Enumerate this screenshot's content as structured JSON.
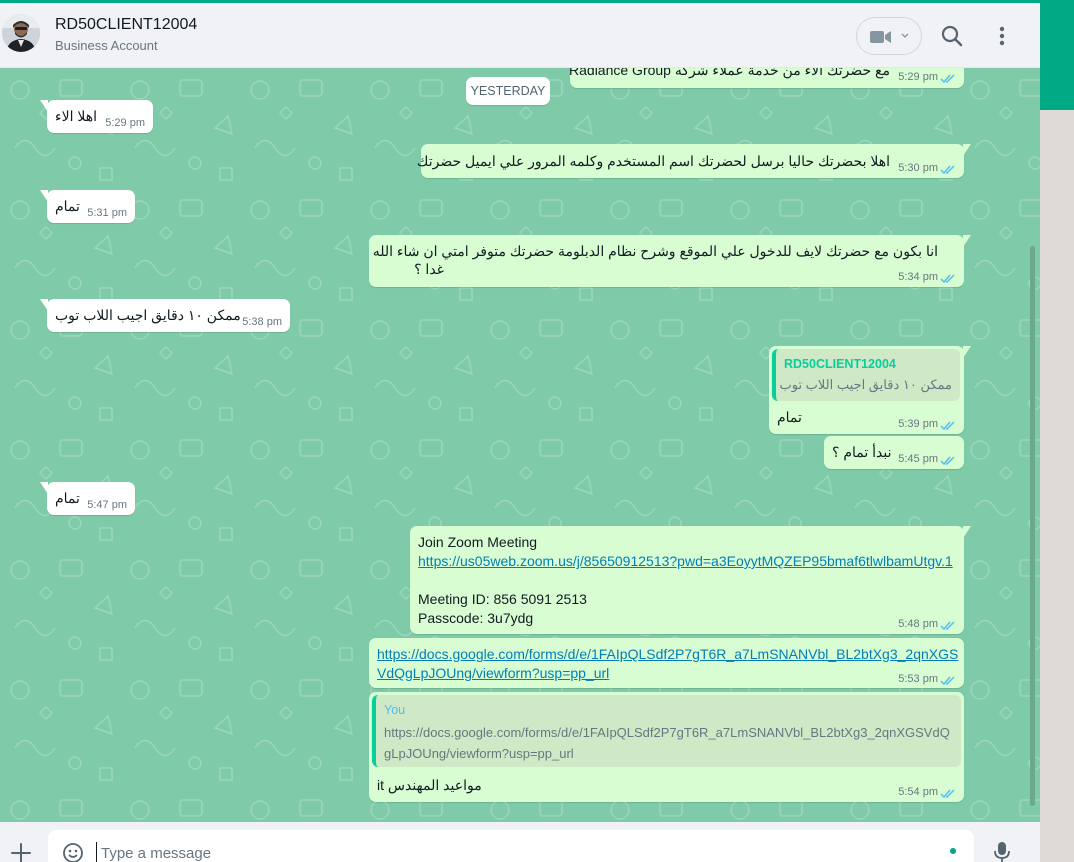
{
  "header": {
    "contact_name": "RD50CLIENT12004",
    "contact_subtitle": "Business Account"
  },
  "date_divider": "YESTERDAY",
  "messages": [
    {
      "direction": "out",
      "text": "مع حضرتك الاء من خدمة عملاء شركه Radiance Group",
      "time": "5:29 pm"
    },
    {
      "direction": "in",
      "text": "اهلا الاء",
      "time": "5:29 pm"
    },
    {
      "direction": "out",
      "text": "اهلا بحضرتك حاليا برسل لحضرتك اسم المستخدم وكلمه المرور علي ايميل حضرتك",
      "time": "5:30 pm"
    },
    {
      "direction": "in",
      "text": "تمام",
      "time": "5:31 pm"
    },
    {
      "direction": "out",
      "lines": [
        "انا بكون مع حضرتك لايف للدخول علي الموقع وشرح نظام الدبلومة حضرتك متوفر امتي ان شاء الله",
        "غدا ؟"
      ],
      "time": "5:34 pm"
    },
    {
      "direction": "in",
      "text": "ممكن ١٠ دقايق اجيب اللاب توب",
      "time": "5:38 pm"
    },
    {
      "direction": "out",
      "quote": {
        "name": "RD50CLIENT12004",
        "text": "ممكن ١٠ دقايق اجيب اللاب توب"
      },
      "text": "تمام",
      "time": "5:39 pm"
    },
    {
      "direction": "out",
      "text": "نبدأ تمام ؟",
      "time": "5:45 pm"
    },
    {
      "direction": "in",
      "text": "تمام",
      "time": "5:47 pm"
    },
    {
      "direction": "out",
      "title": "Join Zoom Meeting",
      "link": "https://us05web.zoom.us/j/85650912513?pwd=a3EoyytMQZEP95bmaf6tlwlbamUtgv.1",
      "meeting_id": "Meeting ID: 856 5091 2513",
      "passcode": "Passcode: 3u7ydg",
      "time": "5:48 pm"
    },
    {
      "direction": "out",
      "link_lines": [
        "https://docs.google.com/forms/d/e/1FAIpQLSdf2P7gT6R_a7LmSNANVbl_BL2btXg3_2qnXGS",
        "VdQgLpJOUng/viewform?usp=pp_url"
      ],
      "time": "5:53 pm"
    },
    {
      "direction": "out",
      "quote": {
        "name": "You",
        "lines": [
          "https://docs.google.com/forms/d/e/1FAIpQLSdf2P7gT6R_a7LmSNANVbl_BL2btXg3_2qnXGSVdQ",
          "gLpJOUng/viewform?usp=pp_url"
        ]
      },
      "text": "مواعيد المهندس it",
      "time": "5:54 pm"
    }
  ],
  "composer": {
    "placeholder": "Type a message"
  },
  "colors": {
    "accent": "#00a884",
    "chat_background": "#7fcaa8",
    "outgoing_bubble": "#d9fdd3",
    "incoming_bubble": "#ffffff",
    "read_tick": "#53bdeb"
  },
  "icons": [
    "video-camera-icon",
    "chevron-down-icon",
    "search-icon",
    "menu-dots-icon",
    "plus-icon",
    "emoji-icon",
    "mic-icon",
    "double-tick-icon"
  ]
}
